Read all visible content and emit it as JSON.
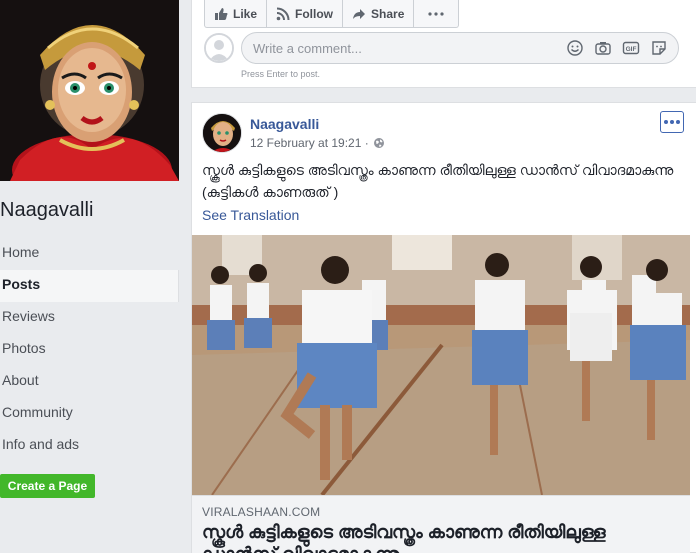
{
  "page": {
    "name": "Naagavalli",
    "create_page_label": "Create a Page"
  },
  "nav": {
    "items": [
      {
        "label": "Home"
      },
      {
        "label": "Posts"
      },
      {
        "label": "Reviews"
      },
      {
        "label": "Photos"
      },
      {
        "label": "About"
      },
      {
        "label": "Community"
      },
      {
        "label": "Info and ads"
      }
    ],
    "active_index": 1
  },
  "actions": {
    "like": "Like",
    "follow": "Follow",
    "share": "Share"
  },
  "comment": {
    "placeholder": "Write a comment...",
    "hint": "Press Enter to post.",
    "gif_label": "GIF"
  },
  "post": {
    "author": "Naagavalli",
    "timestamp": "12 February at 19:21 ·",
    "text": "സ്കൂൾ കുട്ടികളുടെ അടിവസ്ത്രം കാണുന്ന രീതിയിലുള്ള ഡാൻസ് വിവാദമാകുന്നു (കുട്ടികൾ കാണരുത് )",
    "see_translation": "See Translation",
    "link": {
      "domain": "VIRALASHAAN.COM",
      "title": "സ്കൂൾ കുട്ടികളുടെ അടിവസ്ത്രം കാണുന്ന രീതിയിലുള്ള ഡാൻസ് വിവാദമാകുന്നു"
    }
  },
  "colors": {
    "link_blue": "#385898",
    "brand_blue": "#4267b2",
    "create_green": "#42b72a",
    "background": "#e9ebee"
  }
}
